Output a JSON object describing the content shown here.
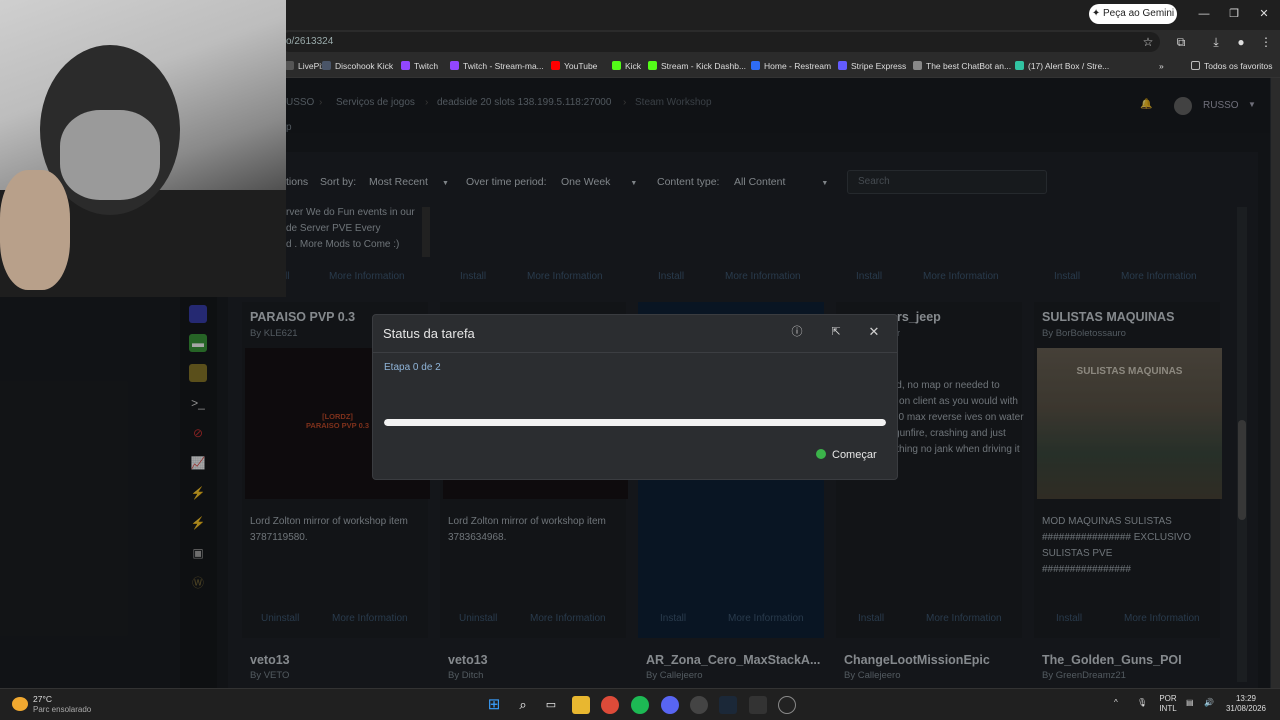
{
  "browser": {
    "gemini_button": "Peça ao Gemini",
    "address": "o/2613324",
    "bookmarks": [
      {
        "label": "LivePix",
        "color": "#555"
      },
      {
        "label": "Discohook Kick",
        "color": "#4a5568"
      },
      {
        "label": "Twitch",
        "color": "#9146ff"
      },
      {
        "label": "Twitch - Stream-ma...",
        "color": "#9146ff"
      },
      {
        "label": "YouTube",
        "color": "#ff0000"
      },
      {
        "label": "Kick",
        "color": "#53fc18"
      },
      {
        "label": "Stream - Kick Dashb...",
        "color": "#53fc18"
      },
      {
        "label": "Home - Restream",
        "color": "#2e6cf6"
      },
      {
        "label": "Stripe Express",
        "color": "#635bff"
      },
      {
        "label": "The best ChatBot an...",
        "color": "#888"
      },
      {
        "label": "(17) Alert Box / Stre...",
        "color": "#31c3a2"
      }
    ],
    "all_bookmarks": "Todos os favoritos"
  },
  "header": {
    "breadcrumb": [
      "USSO",
      "Serviços de jogos",
      "deadside 20 slots 138.199.5.118:27000",
      "Steam Workshop"
    ],
    "user": "RUSSO",
    "sub": "p"
  },
  "filters": {
    "partial_label": "tions",
    "sort_label": "Sort by:",
    "sort_value": "Most Recent",
    "period_label": "Over time period:",
    "period_value": "One Week",
    "content_label": "Content type:",
    "content_value": "All Content",
    "search_placeholder": "Search"
  },
  "top_desc": [
    "rver We do Fun events in our",
    "de Server PVE Every",
    "d . More Mods to Come :)"
  ],
  "row1_buttons": [
    {
      "install": "ll",
      "info": "More Information"
    },
    {
      "install": "Install",
      "info": "More Information"
    },
    {
      "install": "Install",
      "info": "More Information"
    },
    {
      "install": "Install",
      "info": "More Information"
    },
    {
      "install": "Install",
      "info": "More Information"
    }
  ],
  "cards": [
    {
      "title": "PARAISO PVP 0.3",
      "by": "By KLE621",
      "thumb_text": "[LORDZ]\nPARAISO PVP 0.3",
      "desc": "Lord Zolton mirror of workshop item 3787119580.",
      "install": "Uninstall",
      "info": "More Information"
    },
    {
      "title": "",
      "by": "",
      "thumb_text": "",
      "desc": "Lord Zolton mirror of workshop item 3783634968.",
      "install": "Uninstall",
      "info": "More Information"
    },
    {
      "title": "",
      "by": "",
      "thumb_text": "",
      "desc": "",
      "install": "Install",
      "info": "More Information"
    },
    {
      "title": "rs_jeep",
      "by": "r",
      "thumb_text": "",
      "desc": "ndalone mod, no map or needed to work, install on client as you would with ax speed 120 max reverse ives on water reduced m gunfire, crashing and just about everything no jank when driving it",
      "install": "Install",
      "info": "More Information"
    },
    {
      "title": "SULISTAS MAQUINAS",
      "by": "By BorBoletossauro",
      "thumb_text": "SULISTAS MAQUINAS",
      "desc": "MOD MAQUINAS SULISTAS ################ EXCLUSIVO SULISTAS PVE ################",
      "install": "Install",
      "info": "More Information"
    }
  ],
  "bottom_cards": [
    {
      "title": "veto13",
      "by": "By VETO"
    },
    {
      "title": "veto13",
      "by": "By Ditch"
    },
    {
      "title": "AR_Zona_Cero_MaxStackA...",
      "by": "By Callejeero"
    },
    {
      "title": "ChangeLootMissionEpic",
      "by": "By Callejeero"
    },
    {
      "title": "The_Golden_Guns_POI",
      "by": "By GreenDreamz21"
    }
  ],
  "dialog": {
    "title": "Status da tarefa",
    "step": "Etapa 0 de 2",
    "progress": 1.0,
    "start_button": "Começar"
  },
  "taskbar": {
    "temp": "27°C",
    "weather": "Parc ensolarado",
    "lang_top": "POR",
    "lang_bottom": "INTL",
    "time": "13:29",
    "date": "31/08/2026"
  }
}
